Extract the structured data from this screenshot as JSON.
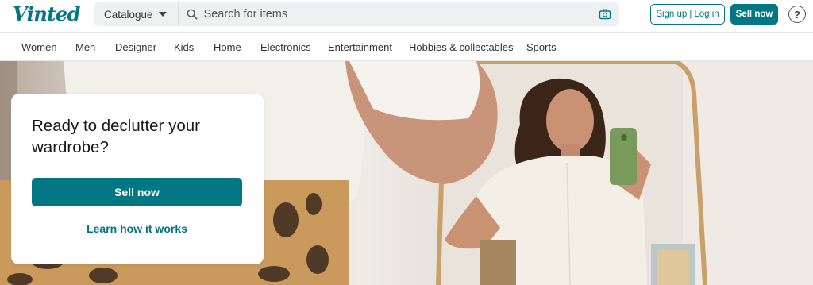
{
  "header": {
    "logo_text": "Vinted",
    "catalogue_label": "Catalogue",
    "search_placeholder": "Search for items",
    "signup_label": "Sign up",
    "login_label": "Log in",
    "auth_separator": "|",
    "sell_label": "Sell now",
    "help_symbol": "?",
    "brand_color": "#007782"
  },
  "nav": {
    "items": [
      "Women",
      "Men",
      "Designer",
      "Kids",
      "Home",
      "Electronics",
      "Entertainment",
      "Hobbies & collectables",
      "Sports"
    ]
  },
  "hero": {
    "title": "Ready to declutter your wardrobe?",
    "sell_button": "Sell now",
    "learn_link": "Learn how it works"
  },
  "icons": {
    "search": "search-icon",
    "camera": "camera-icon",
    "caret": "chevron-down-icon",
    "help": "help-icon"
  }
}
